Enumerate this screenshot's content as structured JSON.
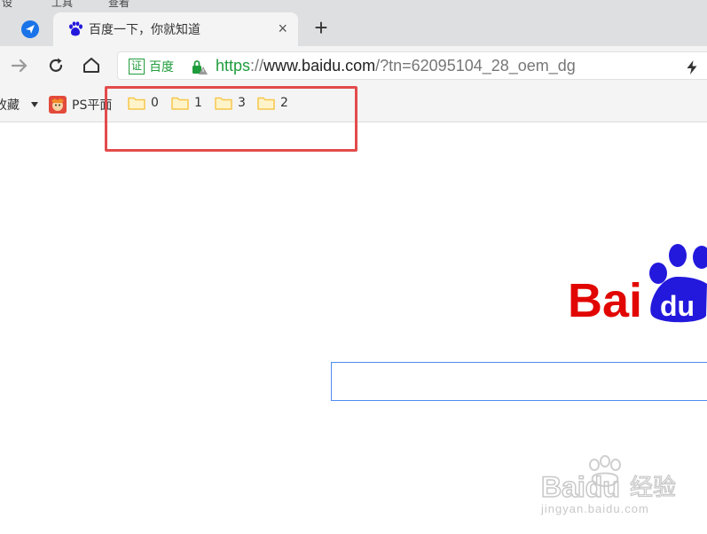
{
  "browser": {
    "top_menu_hints": [
      "设",
      "工具",
      "查看"
    ],
    "tab": {
      "title": "百度一下，你就知道",
      "close_glyph": "×"
    },
    "new_tab_glyph": "+",
    "omnibox": {
      "cert_badge": "证",
      "cert_name": "百度",
      "url_protocol": "https",
      "url_sep": "://",
      "url_host": "www.baidu.com",
      "url_path": "/?tn=62095104_28_oem_dg"
    },
    "bookmarks": {
      "favorites_label": "收藏",
      "items": [
        {
          "label": "PS平面",
          "icon": "ps-favicon-icon"
        },
        {
          "label": "0",
          "icon": "folder-icon"
        },
        {
          "label": "1",
          "icon": "folder-icon"
        },
        {
          "label": "3",
          "icon": "folder-icon"
        },
        {
          "label": "2",
          "icon": "folder-icon"
        }
      ]
    }
  },
  "page": {
    "logo_text_left": "Bai",
    "logo_text_right": "du",
    "watermark_brand": "Baidu",
    "watermark_suffix": "经验",
    "watermark_url": "jingyan.baidu.com"
  },
  "colors": {
    "accent_green": "#1f9c3b",
    "highlight_red": "#e34b4b",
    "baidu_red": "#e10602",
    "baidu_blue": "#2319dc",
    "search_border": "#4e8cf0",
    "folder_yellow": "#f6c74a"
  }
}
